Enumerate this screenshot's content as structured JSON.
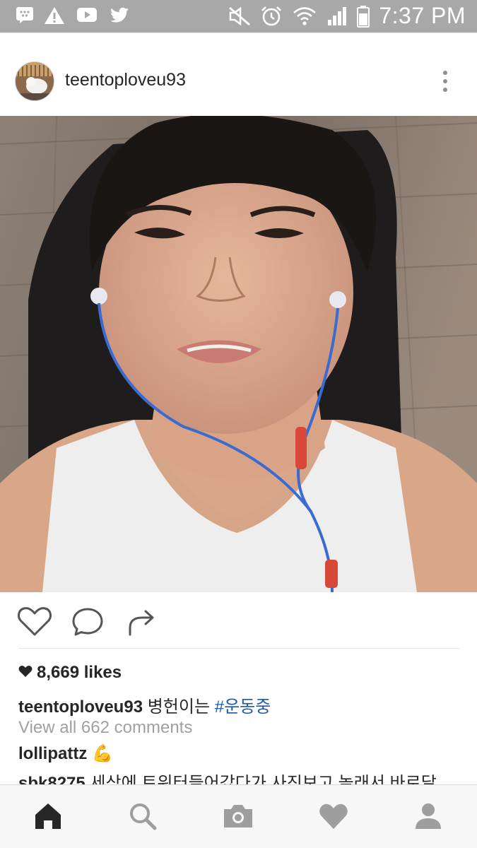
{
  "status_bar": {
    "time": "7:37 PM",
    "left_icons": [
      "bbm-icon",
      "warning-icon",
      "youtube-icon",
      "twitter-icon"
    ],
    "right_icons": [
      "mute-icon",
      "alarm-icon",
      "wifi-icon",
      "signal-icon",
      "battery-icon"
    ]
  },
  "post": {
    "username": "teentoploveu93",
    "likes_count": "8,669 likes",
    "caption": {
      "user": "teentoploveu93",
      "text": "병헌이는",
      "hashtag": "#운동중"
    },
    "view_all_comments": "View all 662 comments",
    "comments": [
      {
        "user": "lollipattz",
        "text": "💪"
      },
      {
        "user": "sbk8275",
        "text": "세상에 트위터들어갔다가 사진보고 놀래서 바로달"
      }
    ]
  },
  "colors": {
    "status_bar_bg": "#a8a8a8",
    "hashtag": "#1e5aa8",
    "muted_text": "#a0a0a0",
    "nav_bg": "#f7f7f7"
  },
  "bottom_nav": {
    "items": [
      "home-icon",
      "search-icon",
      "camera-icon",
      "heart-icon",
      "profile-icon"
    ]
  }
}
